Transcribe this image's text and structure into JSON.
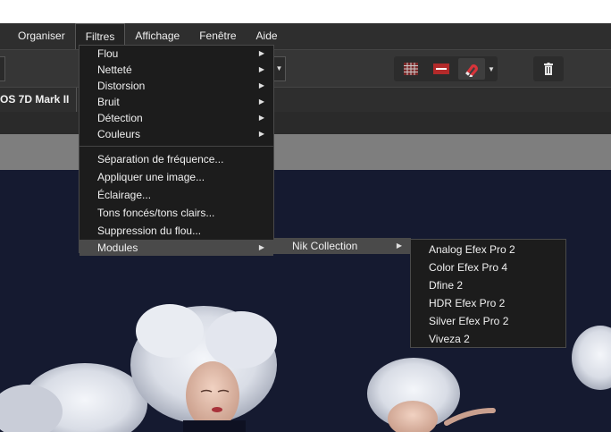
{
  "menubar": {
    "items": [
      {
        "label": "Organiser"
      },
      {
        "label": "Filtres",
        "active": true
      },
      {
        "label": "Affichage"
      },
      {
        "label": "Fenêtre"
      },
      {
        "label": "Aide"
      }
    ]
  },
  "toolbar": {
    "icons": [
      "grid-icon",
      "minus-box-icon",
      "magnet-icon",
      "trash-icon"
    ]
  },
  "infobar": {
    "camera": "OS 7D Mark II"
  },
  "filters_menu": {
    "group1": [
      {
        "label": "Flou",
        "submenu": true
      },
      {
        "label": "Netteté",
        "submenu": true
      },
      {
        "label": "Distorsion",
        "submenu": true
      },
      {
        "label": "Bruit",
        "submenu": true
      },
      {
        "label": "Détection",
        "submenu": true
      },
      {
        "label": "Couleurs",
        "submenu": true
      }
    ],
    "group2": [
      {
        "label": "Séparation de fréquence..."
      },
      {
        "label": "Appliquer une image..."
      },
      {
        "label": "Éclairage..."
      },
      {
        "label": "Tons foncés/tons clairs..."
      },
      {
        "label": "Suppression du flou..."
      }
    ],
    "modules": {
      "label": "Modules",
      "submenu": true,
      "highlighted": true
    }
  },
  "modules_menu": {
    "item": {
      "label": "Nik Collection",
      "submenu": true,
      "highlighted": true
    }
  },
  "nik_menu": {
    "items": [
      {
        "label": "Analog Efex Pro 2"
      },
      {
        "label": "Color Efex Pro 4"
      },
      {
        "label": "Dfine 2"
      },
      {
        "label": "HDR Efex Pro 2"
      },
      {
        "label": "Silver Efex Pro 2"
      },
      {
        "label": "Viveza 2"
      }
    ]
  },
  "colors": {
    "menubar_bg": "#2e2e2e",
    "menu_bg": "#1c1c1c",
    "highlight": "#4a4a4a",
    "canvas_bg": "#151a30",
    "magnet_red": "#d8343a"
  }
}
